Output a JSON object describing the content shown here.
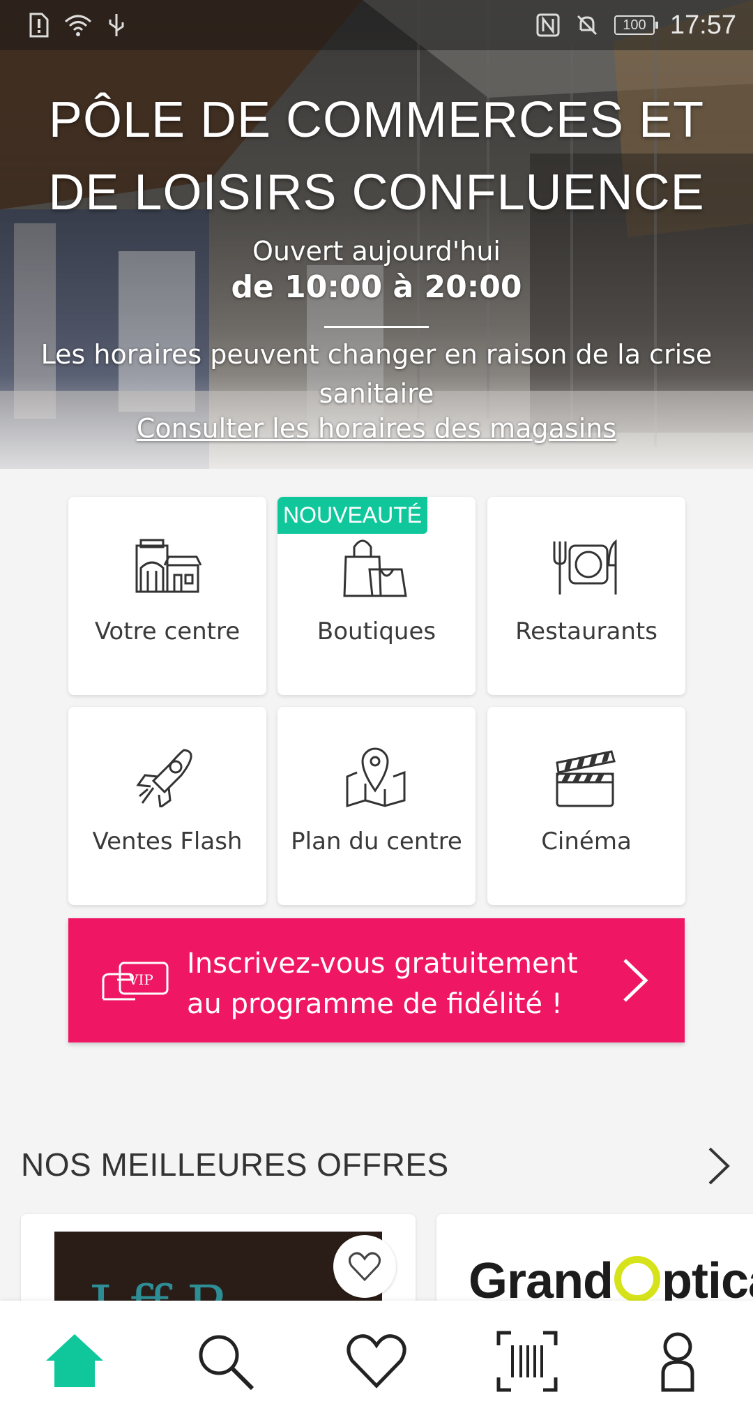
{
  "status_bar": {
    "time": "17:57",
    "battery": "100"
  },
  "hero": {
    "title": "PÔLE DE COMMERCES ET DE LOISIRS CONFLUENCE",
    "open_today": "Ouvert aujourd'hui",
    "hours": "de 10:00 à 20:00",
    "notice": "Les horaires peuvent changer en raison de la crise sanitaire",
    "stores_link": "Consulter les horaires des magasins"
  },
  "tiles": [
    {
      "label": "Votre centre",
      "icon": "shopping-center-icon"
    },
    {
      "label": "Boutiques",
      "icon": "shopping-bags-icon",
      "badge": "NOUVEAUTÉ"
    },
    {
      "label": "Restaurants",
      "icon": "plate-cutlery-icon"
    },
    {
      "label": "Ventes Flash",
      "icon": "rocket-icon"
    },
    {
      "label": "Plan du centre",
      "icon": "map-pin-icon"
    },
    {
      "label": "Cinéma",
      "icon": "clapperboard-icon"
    }
  ],
  "loyalty": {
    "vip": "VIP",
    "text": "Inscrivez-vous gratuitement au programme de fidélité !"
  },
  "offers": {
    "title": "NOS MEILLEURES OFFRES",
    "cards": [
      {
        "brand_text": "J  ff   R"
      },
      {
        "brand_before": "Grand",
        "brand_after": "ptica"
      }
    ]
  },
  "colors": {
    "accent": "#10c79c",
    "loyalty": "#ef1663",
    "home_active": "#10c79c"
  },
  "nav": [
    "home-icon",
    "search-icon",
    "heart-icon",
    "barcode-scan-icon",
    "profile-icon"
  ]
}
